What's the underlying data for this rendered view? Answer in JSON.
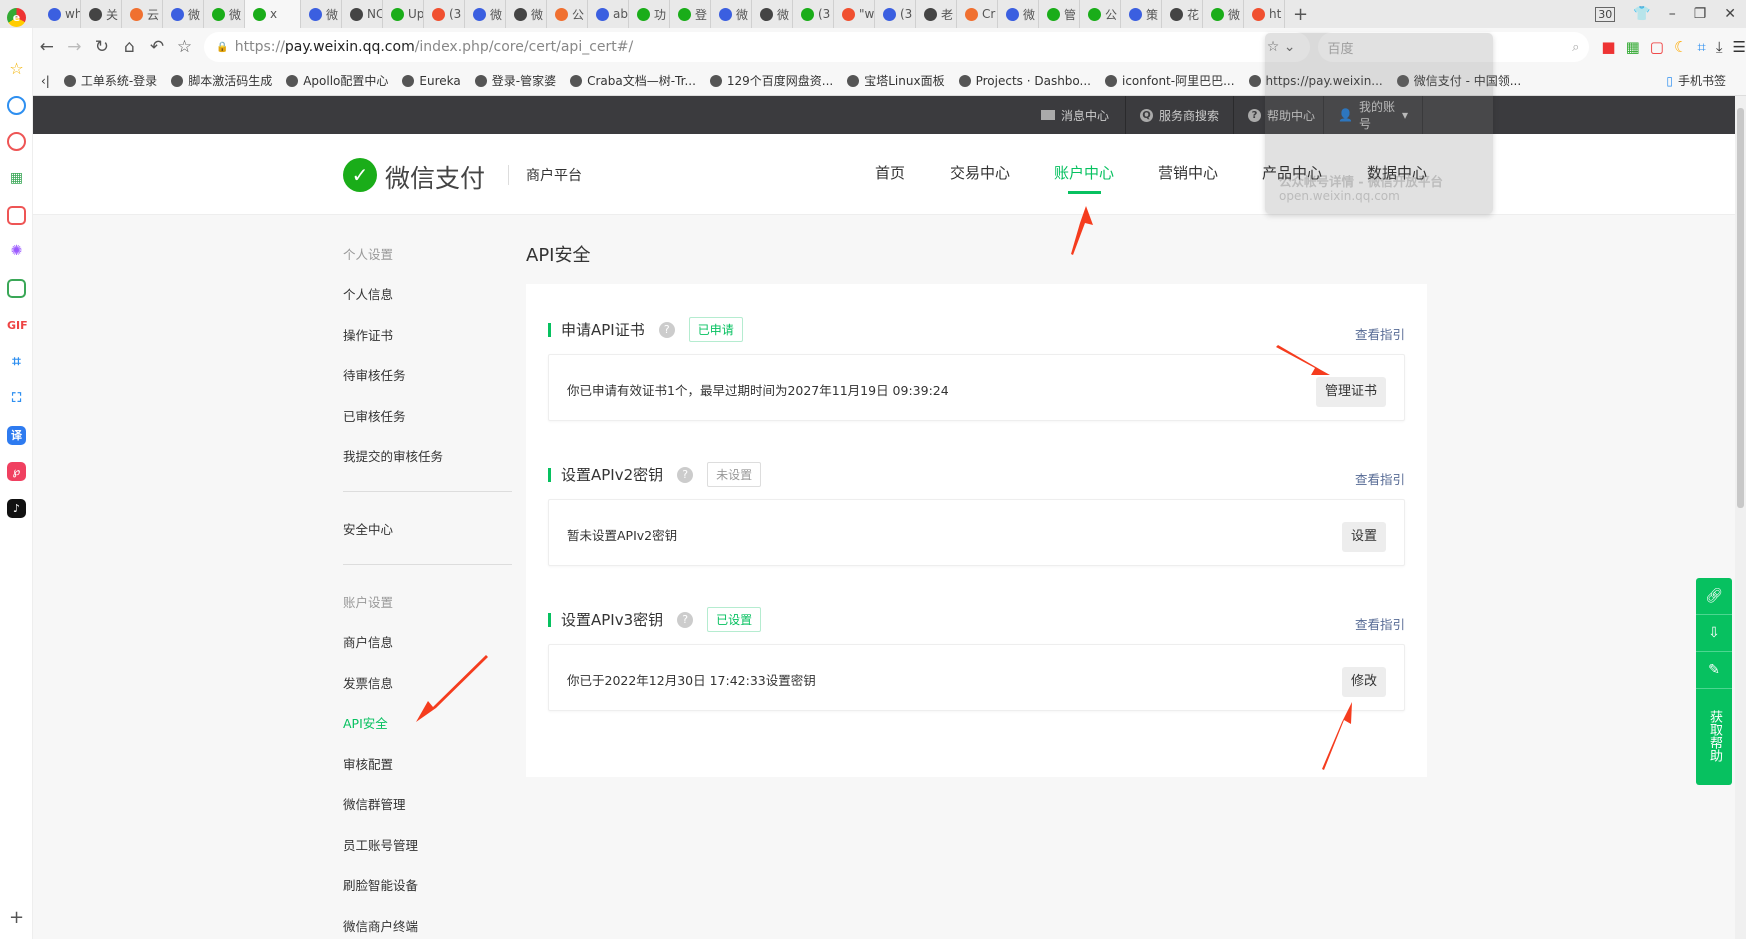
{
  "browser": {
    "tabs": [
      "wh",
      "关",
      "云",
      "微",
      "微",
      "x",
      "微",
      "NC",
      "Up",
      "(3",
      "微",
      "微",
      "公",
      "ab",
      "功",
      "登",
      "微",
      "微",
      "(3",
      "\"w",
      "(3",
      "老",
      "Cr",
      "微",
      "管",
      "公",
      "策",
      "花",
      "微",
      "ht"
    ],
    "new_tab": "+",
    "tab_count": "30",
    "url_prefix": "https://",
    "url_host": "pay.weixin.qq.com",
    "url_path": "/index.php/core/cert/api_cert#/",
    "search_placeholder": "百度",
    "bookmarks": [
      "工单系统-登录",
      "脚本激活码生成",
      "Apollo配置中心",
      "Eureka",
      "登录-管家婆",
      "Craba文档—树-Tr...",
      "129个百度网盘资...",
      "宝塔Linux面板",
      "Projects · Dashbo...",
      "iconfont-阿里巴巴...",
      "https://pay.weixin...",
      "微信支付 - 中国领..."
    ],
    "mobile_bookmarks": "手机书签",
    "left_gif": "GIF",
    "left_translate": "译"
  },
  "popup": {
    "title": "公众帐号详情 - 微信开放平台",
    "url": "open.weixin.qq.com"
  },
  "header": {
    "items": [
      "消息中心",
      "服务商搜索",
      "帮助中心",
      "我的账号"
    ]
  },
  "brand": {
    "name": "微信支付",
    "platform": "商户平台"
  },
  "nav": [
    "首页",
    "交易中心",
    "账户中心",
    "营销中心",
    "产品中心",
    "数据中心"
  ],
  "sidebar": {
    "group1": "个人设置",
    "items1": [
      "个人信息",
      "操作证书",
      "待审核任务",
      "已审核任务",
      "我提交的审核任务"
    ],
    "security": "安全中心",
    "group2": "账户设置",
    "items2": [
      "商户信息",
      "发票信息",
      "API安全",
      "审核配置",
      "微信群管理",
      "员工账号管理",
      "刷脸智能设备",
      "微信商户终端"
    ]
  },
  "page": {
    "title": "API安全"
  },
  "sections": [
    {
      "title": "申请API证书",
      "status": "已申请",
      "guide": "查看指引",
      "text": "你已申请有效证书1个，最早过期时间为2027年11月19日 09:39:24",
      "button": "管理证书"
    },
    {
      "title": "设置APIv2密钥",
      "status": "未设置",
      "guide": "查看指引",
      "text": "暂未设置APIv2密钥",
      "button": "设置"
    },
    {
      "title": "设置APIv3密钥",
      "status": "已设置",
      "guide": "查看指引",
      "text": "你已于2022年12月30日 17:42:33设置密钥",
      "button": "修改"
    }
  ],
  "floatbar": {
    "help": "获取帮助"
  },
  "colors": {
    "accent": "#07c160",
    "link": "#576b95",
    "header": "#3b3b3e",
    "arrow": "#f53c1e"
  }
}
